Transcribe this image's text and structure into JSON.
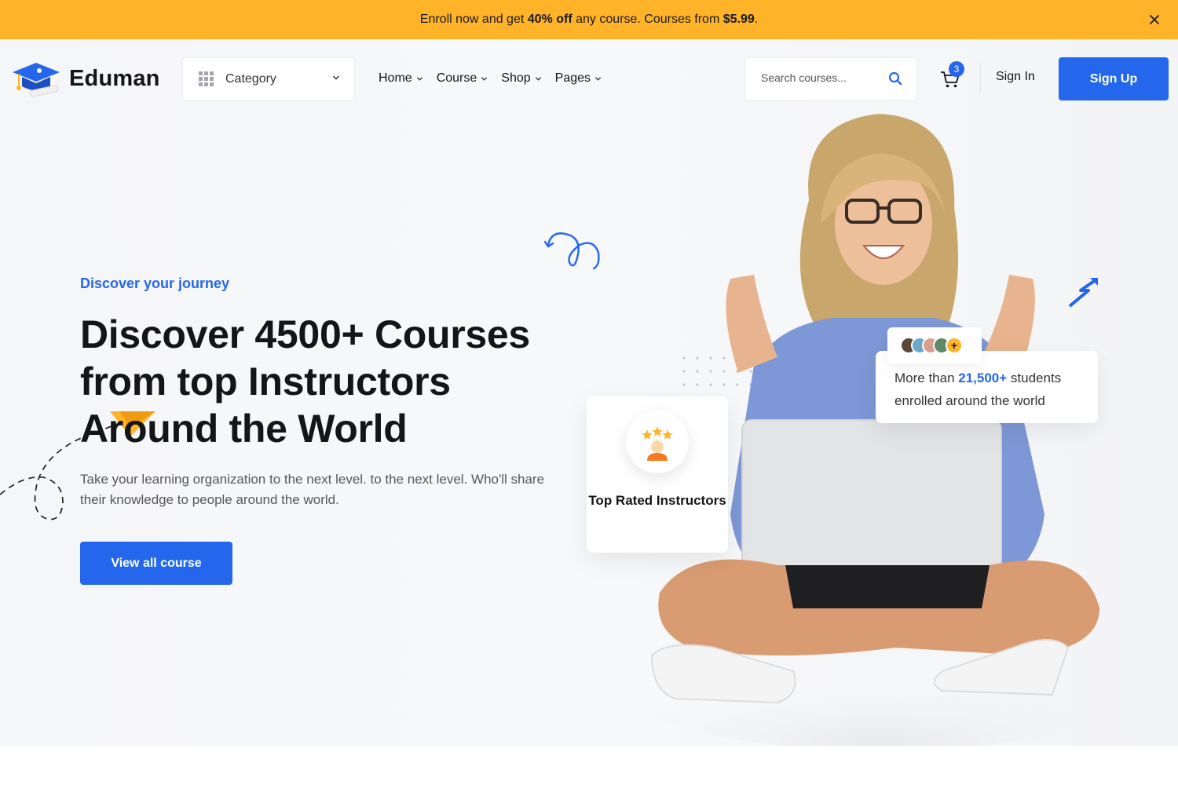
{
  "promo": {
    "prefix": "Enroll now and get ",
    "discount": "40% off",
    "middle": " any course. Courses from ",
    "price": "$5.99",
    "suffix": "."
  },
  "header": {
    "logo_text": "Eduman",
    "category_label": "Category",
    "nav": [
      {
        "label": "Home"
      },
      {
        "label": "Course"
      },
      {
        "label": "Shop"
      },
      {
        "label": "Pages"
      }
    ],
    "search_placeholder": "Search courses...",
    "cart_count": "3",
    "sign_in": "Sign In",
    "sign_up": "Sign Up"
  },
  "hero": {
    "subtitle": "Discover your journey",
    "title": "Discover 4500+ Courses from top Instructors Around the World",
    "description": "Take your learning organization to the next level. to the next level. Who'll share their knowledge to people around the world.",
    "cta": "View all course"
  },
  "cards": {
    "instructors": "Top Rated Instructors",
    "students_prefix": "More than ",
    "students_count": "21,500+",
    "students_suffix": " students enrolled around the world"
  },
  "colors": {
    "accent": "#2467ec",
    "promo_bg": "#ffb329"
  },
  "icons": [
    "close-icon",
    "grid-icon",
    "chevron-down-icon",
    "search-icon",
    "cart-icon"
  ]
}
